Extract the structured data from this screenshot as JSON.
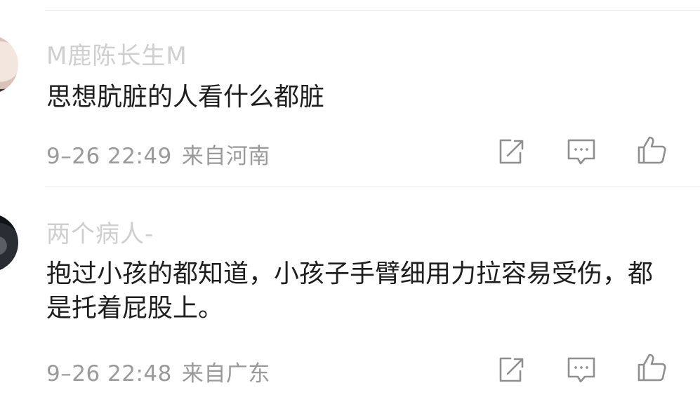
{
  "comments": [
    {
      "username": "M鹿陈长生M",
      "text": "思想肮脏的人看什么都脏",
      "time": "9–26 22:49",
      "location": "来自河南"
    },
    {
      "username": "两个病人-",
      "text": "抱过小孩的都知道，小孩子手臂细用力拉容易受伤，都是托着屁股上。",
      "time": "9–26 22:48",
      "location": "来自广东"
    }
  ],
  "icons": {
    "share": "share-icon",
    "comment": "comment-icon",
    "like": "thumbs-up-icon"
  },
  "colors": {
    "username": "#cfcfcf",
    "content": "#1e1e1e",
    "meta": "#9a9a9a",
    "divider": "#e6e6e6"
  }
}
